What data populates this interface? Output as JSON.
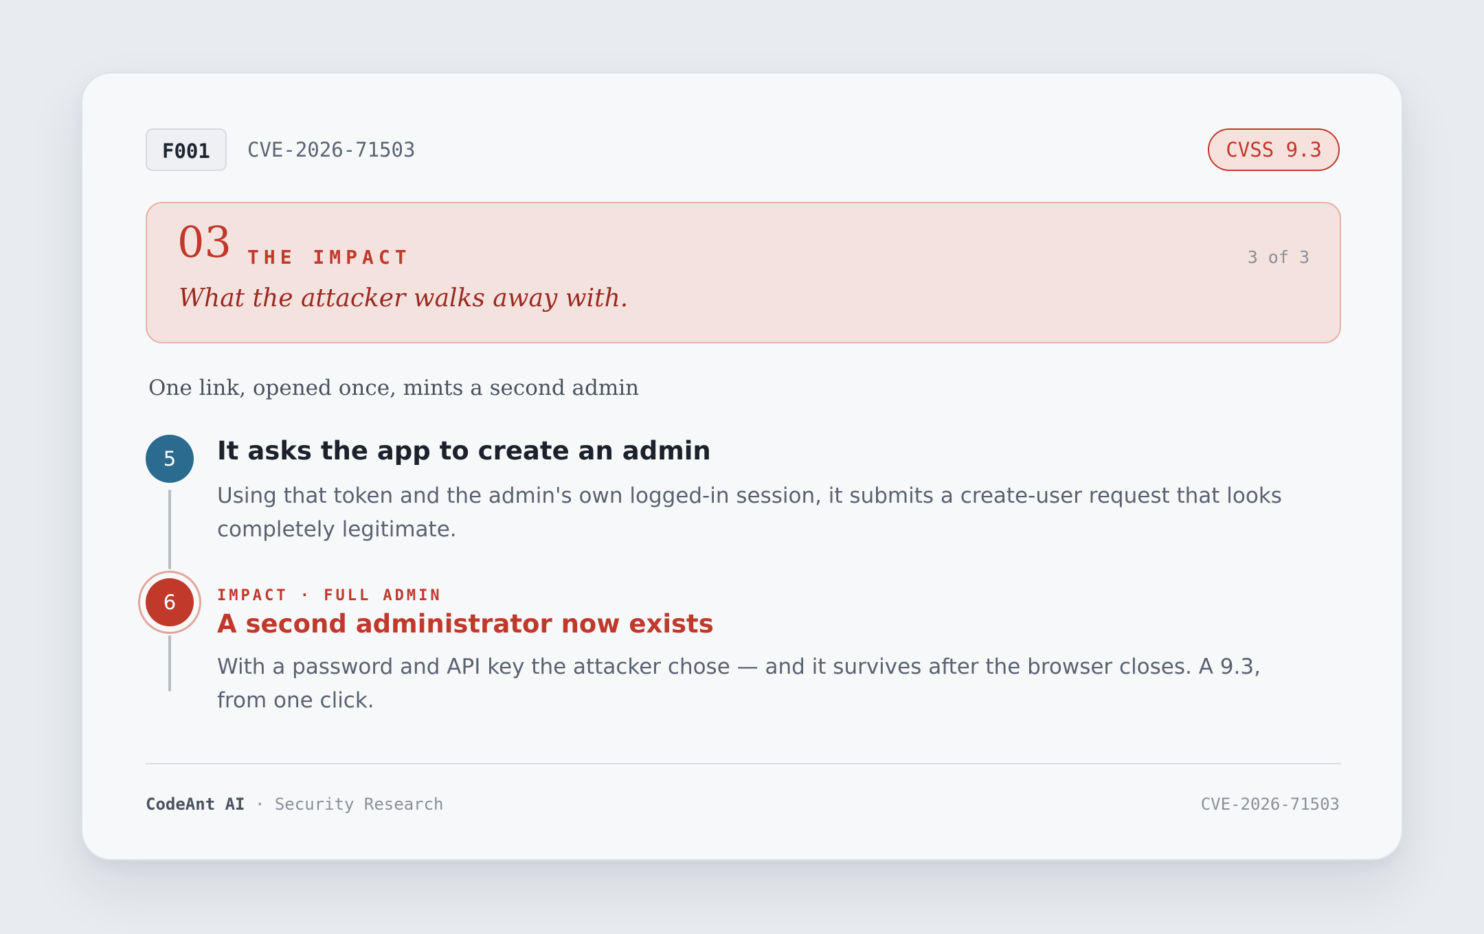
{
  "header": {
    "finding_id": "F001",
    "cve_id": "CVE-2026-71503",
    "cvss_label": "CVSS 9.3"
  },
  "stage": {
    "number": "03",
    "label": "THE IMPACT",
    "count": "3 of 3",
    "tagline": "What the attacker walks away with."
  },
  "section_title": "One link, opened once, mints a second admin",
  "steps": [
    {
      "number": "5",
      "title": "It asks the app to create an admin",
      "body": "Using that token and the admin's own logged-in session, it submits a create-user request that looks completely legitimate."
    },
    {
      "number": "6",
      "kicker": "IMPACT · FULL ADMIN",
      "title": "A second administrator now exists",
      "body": "With a password and API key the attacker chose — and it survives after the browser closes. A 9.3, from one click."
    }
  ],
  "footer": {
    "brand": "CodeAnt AI",
    "separator": " · ",
    "subtitle": "Security Research",
    "cve_id": "CVE-2026-71503"
  },
  "colors": {
    "accent_red": "#c0392b",
    "step_blue": "#2a6b8f",
    "panel_bg": "#f4e2df",
    "card_bg": "#f7f8fa"
  }
}
